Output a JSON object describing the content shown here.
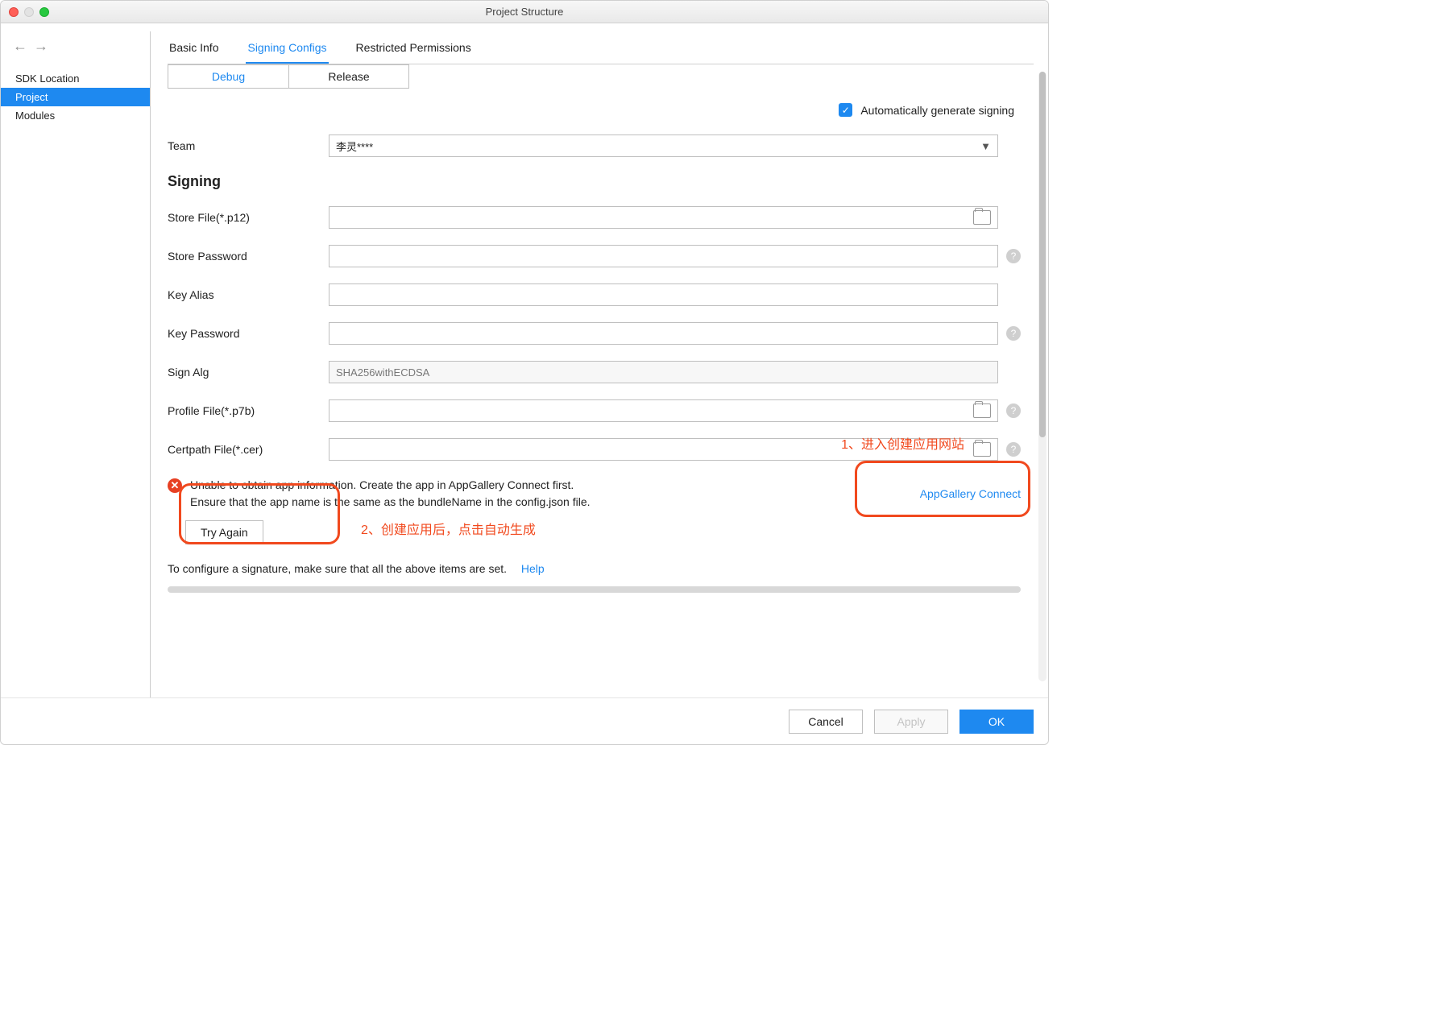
{
  "title": "Project Structure",
  "sidebar": {
    "items": [
      "SDK Location",
      "Project",
      "Modules"
    ],
    "selectedIndex": 1
  },
  "tabs": {
    "items": [
      "Basic Info",
      "Signing Configs",
      "Restricted Permissions"
    ],
    "activeIndex": 1
  },
  "subtabs": {
    "items": [
      "Debug",
      "Release"
    ],
    "activeIndex": 0
  },
  "autosign": {
    "label": "Automatically generate signing",
    "checked": true
  },
  "form": {
    "team_label": "Team",
    "team_value": "李灵****",
    "signing_heading": "Signing",
    "store_file_label": "Store File(*.p12)",
    "store_file_value": "",
    "store_password_label": "Store Password",
    "store_password_value": "",
    "key_alias_label": "Key Alias",
    "key_alias_value": "",
    "key_password_label": "Key Password",
    "key_password_value": "",
    "sign_alg_label": "Sign Alg",
    "sign_alg_value": "SHA256withECDSA",
    "profile_file_label": "Profile File(*.p7b)",
    "profile_file_value": "",
    "certpath_file_label": "Certpath File(*.cer)",
    "certpath_file_value": ""
  },
  "error": {
    "line1": "Unable to obtain app information. Create the app in AppGallery Connect first.",
    "line2": "Ensure that the app name is the same as the bundleName in the config.json file.",
    "link": "AppGallery Connect",
    "try_again": "Try Again"
  },
  "annotations": {
    "a1": "1、进入创建应用网站",
    "a2": "2、创建应用后，点击自动生成"
  },
  "hint": {
    "text": "To configure a signature, make sure that all the above items are set.",
    "help": "Help"
  },
  "footer": {
    "cancel": "Cancel",
    "apply": "Apply",
    "ok": "OK"
  }
}
